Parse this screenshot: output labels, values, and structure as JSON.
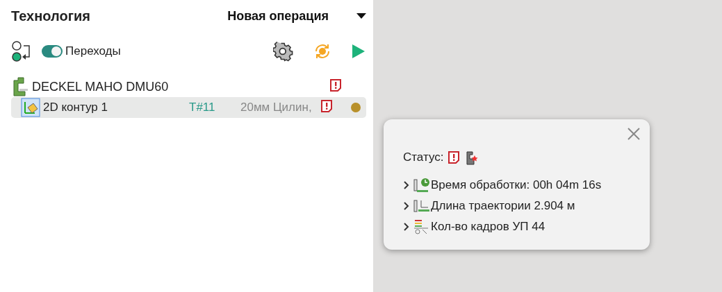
{
  "panel": {
    "title": "Технология",
    "operation_menu": "Новая операция"
  },
  "toolbar": {
    "toggle": {
      "label": "Переходы",
      "on": true
    }
  },
  "tree": [
    {
      "label": "DECKEL MAHO DMU60",
      "children": [
        {
          "label": "2D контур 1",
          "selected": true,
          "tool": "T#11",
          "tool_desc": "20мм Цилин,",
          "color": "#b8902a"
        }
      ]
    }
  ],
  "popup": {
    "status_label": "Статус:",
    "status_icons": [
      {
        "kind": "error"
      },
      {
        "kind": "machine"
      }
    ],
    "stats": [
      {
        "kind": "time",
        "text": "Время обработки: 00h 04m 16s",
        "expanded": false
      },
      {
        "kind": "length",
        "text": "Длина траектории 2.904 м",
        "expanded": false
      },
      {
        "kind": "frames",
        "text": "Кол-во кадров УП 44",
        "expanded": false
      }
    ]
  }
}
